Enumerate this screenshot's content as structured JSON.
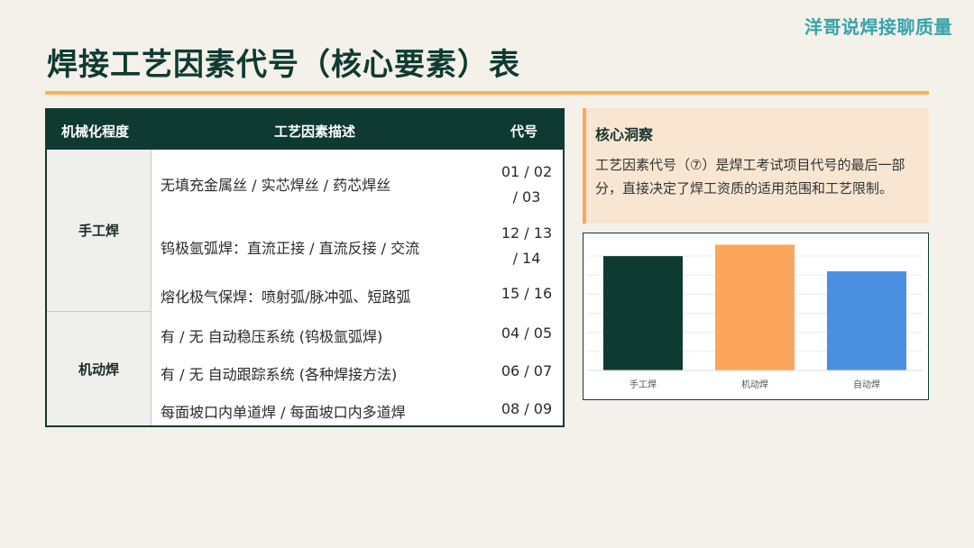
{
  "brand": "洋哥说焊接聊质量",
  "title": "焊接工艺因素代号（核心要素）表",
  "table": {
    "headers": [
      "机械化程度",
      "工艺因素描述",
      "代号"
    ],
    "groups": [
      {
        "name": "手工焊",
        "rows": [
          {
            "desc": "无填充金属丝 / 实芯焊丝 / 药芯焊丝",
            "code_line1": "01 / 02",
            "code_line2": "/ 03"
          },
          {
            "desc": "钨极氩弧焊：直流正接 / 直流反接 / 交流",
            "code_line1": "12 / 13",
            "code_line2": "/ 14"
          },
          {
            "desc": "熔化极气保焊：喷射弧/脉冲弧、短路弧",
            "code_line1": "15 / 16",
            "code_line2": ""
          }
        ]
      },
      {
        "name": "机动焊",
        "rows": [
          {
            "desc": "有 / 无 自动稳压系统 (钨极氩弧焊)",
            "code_line1": "04 / 05",
            "code_line2": ""
          },
          {
            "desc": "有 / 无 自动跟踪系统 (各种焊接方法)",
            "code_line1": "06 / 07",
            "code_line2": ""
          },
          {
            "desc": "每面坡口内单道焊 / 每面坡口内多道焊",
            "code_line1": "08 / 09",
            "code_line2": ""
          }
        ]
      }
    ]
  },
  "insight": {
    "title": "核心洞察",
    "line1": "工艺因素代号（⑦）是焊工考试项目代号的最后一部",
    "line2": "分，直接决定了焊工资质的适用范围和工艺限制。"
  },
  "chart_data": {
    "type": "bar",
    "categories": [
      "手工焊",
      "机动焊",
      "自动焊"
    ],
    "values": [
      3,
      3.3,
      2.6
    ],
    "colors": [
      "#0f3a31",
      "#fba65a",
      "#4a8fe0"
    ],
    "ylim": [
      0,
      3.5
    ],
    "grid": true,
    "title": "",
    "xlabel": "",
    "ylabel": ""
  }
}
